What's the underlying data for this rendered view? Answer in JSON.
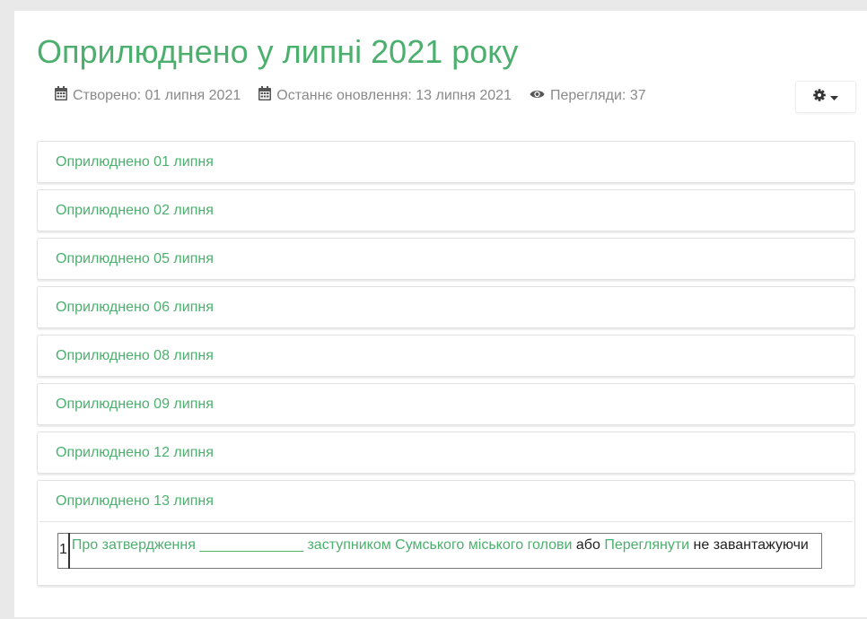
{
  "page": {
    "title": "Оприлюднено у липні 2021 року"
  },
  "meta": {
    "created": "Створено: 01 липня 2021",
    "updated": "Останнє оновлення: 13 липня 2021",
    "views": "Перегляди: 37",
    "icons": [
      "calendar-icon",
      "calendar-icon",
      "eye-icon"
    ]
  },
  "toolbar": {
    "icons": [
      "gear-icon",
      "caret-down-icon"
    ]
  },
  "accordion": {
    "items": [
      {
        "label": "Оприлюднено 01 липня"
      },
      {
        "label": "Оприлюднено 02 липня"
      },
      {
        "label": "Оприлюднено 05 липня"
      },
      {
        "label": "Оприлюднено 06 липня"
      },
      {
        "label": "Оприлюднено 08 липня"
      },
      {
        "label": "Оприлюднено 09 липня"
      },
      {
        "label": "Оприлюднено 12 липня"
      },
      {
        "label": "Оприлюднено 13 липня"
      }
    ],
    "expanded_index": 7,
    "content": {
      "row_number": "1",
      "link_text": "Про затвердження _____________ заступником Сумського міського голови",
      "or_text": " або ",
      "view_link": "Переглянути",
      "after_text": " не завантажуючи"
    }
  },
  "colors": {
    "accent": "#4caf6e",
    "meta_text": "#8a8a8a",
    "background": "#e9e9e9"
  }
}
